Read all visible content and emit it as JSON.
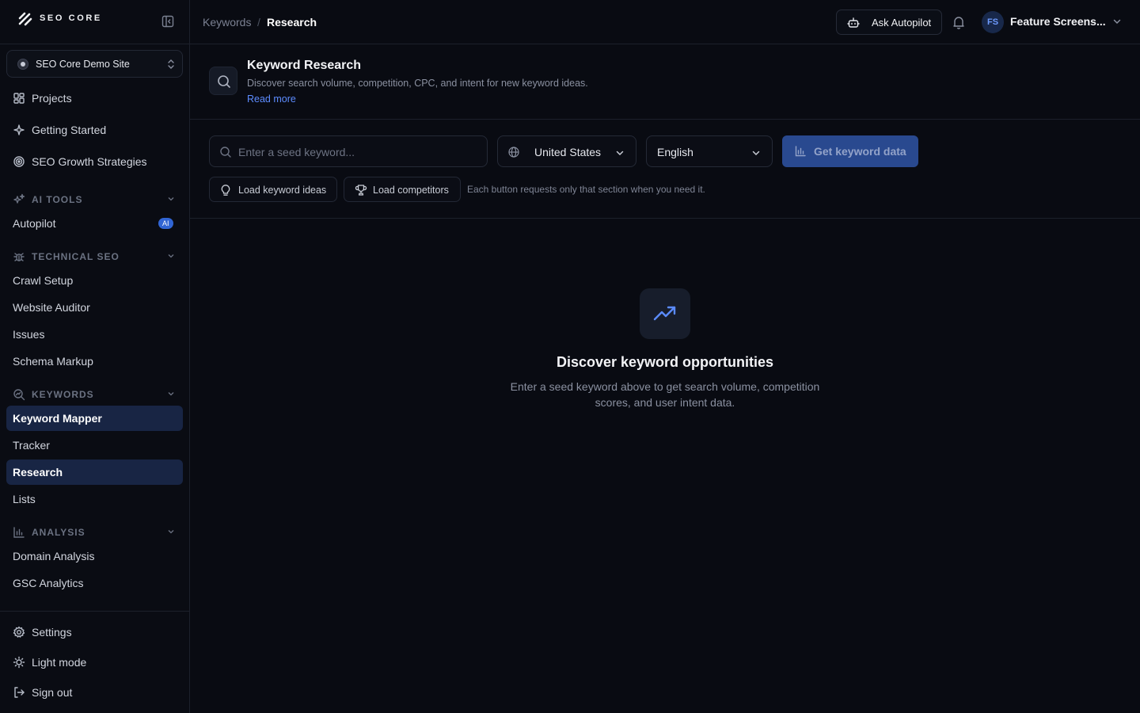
{
  "brand": {
    "name": "SEO CORE"
  },
  "site_selector": {
    "value": "SEO Core Demo Site"
  },
  "sidebar": {
    "top_items": [
      {
        "label": "Projects",
        "icon": "grid-icon"
      },
      {
        "label": "Getting Started",
        "icon": "sparkle-icon"
      },
      {
        "label": "SEO Growth Strategies",
        "icon": "target-icon"
      }
    ],
    "sections": {
      "ai_tools": {
        "label": "AI TOOLS",
        "items": [
          {
            "label": "Autopilot",
            "badge": "AI"
          }
        ]
      },
      "technical_seo": {
        "label": "TECHNICAL SEO",
        "items": [
          {
            "label": "Crawl Setup"
          },
          {
            "label": "Website Auditor"
          },
          {
            "label": "Issues"
          },
          {
            "label": "Schema Markup"
          }
        ]
      },
      "keywords": {
        "label": "KEYWORDS",
        "items": [
          {
            "label": "Keyword Mapper"
          },
          {
            "label": "Tracker"
          },
          {
            "label": "Research"
          },
          {
            "label": "Lists"
          }
        ]
      },
      "analysis": {
        "label": "ANALYSIS",
        "items": [
          {
            "label": "Domain Analysis"
          },
          {
            "label": "GSC Analytics"
          }
        ]
      }
    },
    "bottom_items": [
      {
        "label": "Settings",
        "icon": "gear-icon"
      },
      {
        "label": "Light mode",
        "icon": "sun-icon"
      },
      {
        "label": "Sign out",
        "icon": "sign-out-icon"
      }
    ]
  },
  "topbar": {
    "breadcrumb": [
      "Keywords",
      "Research"
    ],
    "breadcrumb_separator": "/",
    "ask_button": "Ask Autopilot",
    "user": {
      "initials": "FS",
      "name": "Feature Screens..."
    }
  },
  "page_header": {
    "title": "Keyword Research",
    "description": "Discover search volume, competition, CPC, and intent for new keyword ideas.",
    "link": "Read more"
  },
  "controls": {
    "seed_placeholder": "Enter a seed keyword...",
    "seed_value": "",
    "country": "United States",
    "language": "English",
    "submit": "Get keyword data",
    "load_ideas": "Load keyword ideas",
    "load_competitors": "Load competitors",
    "hint": "Each button requests only that section when you need it."
  },
  "empty_state": {
    "title": "Discover keyword opportunities",
    "description": "Enter a seed keyword above to get search volume, competition scores, and user intent data."
  },
  "colors": {
    "background": "#090b12",
    "accent": "#3165d4",
    "active_nav": "#182544",
    "link": "#5d8cff"
  }
}
